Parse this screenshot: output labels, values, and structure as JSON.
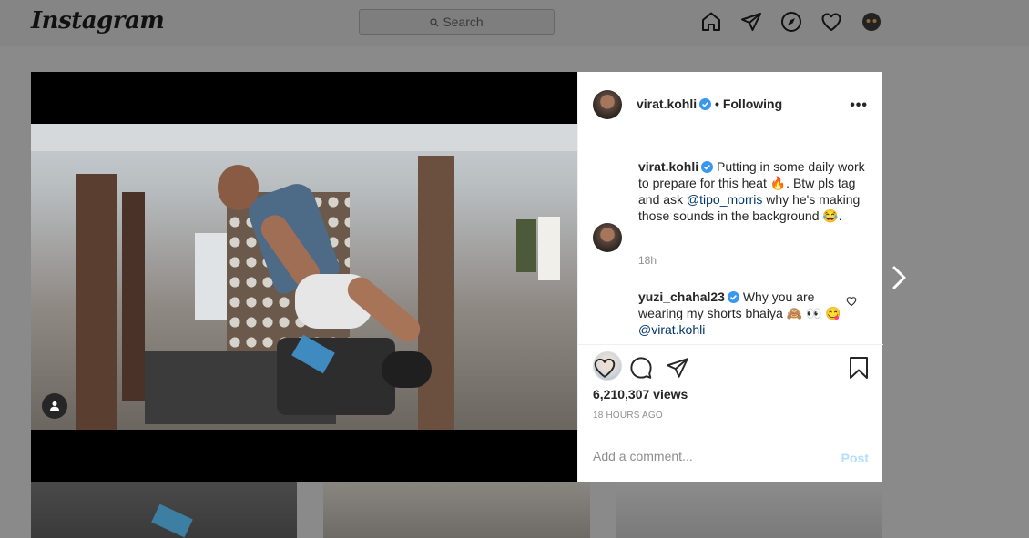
{
  "nav": {
    "logo": "Instagram",
    "search_placeholder": "Search",
    "icons": [
      "home-icon",
      "direct-icon",
      "explore-icon",
      "heart-icon",
      "profile-avatar"
    ]
  },
  "post": {
    "author": "virat.kohli",
    "follow_status": "• Following",
    "caption_pre": " Putting in some daily work to prepare for this heat 🔥. Btw pls tag and ask ",
    "caption_mention": "@tipo_morris",
    "caption_post": " why he's making those sounds in the background 😂.",
    "caption_time": "18h",
    "comment": {
      "author": "yuzi_chahal23",
      "text": " Why you are wearing my shorts bhaiya 🙈 👀 😋 ",
      "mention": "@virat.kohli"
    },
    "views": "6,210,307 views",
    "posted_ago": "18 HOURS AGO",
    "add_comment_placeholder": "Add a comment...",
    "post_label": "Post"
  },
  "colors": {
    "verified": "#3897f0",
    "mention": "#00376b",
    "post_disabled": "#b2dffc"
  }
}
